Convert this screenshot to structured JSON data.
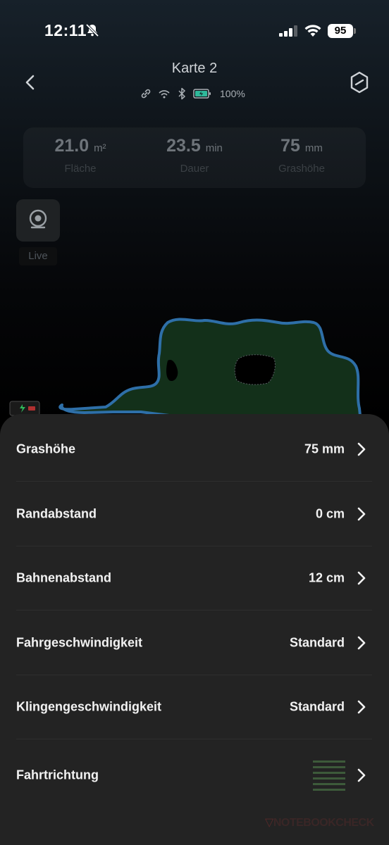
{
  "status": {
    "time": "12:11",
    "battery": "95"
  },
  "header": {
    "title": "Karte 2",
    "battery_pct": "100%"
  },
  "stats": [
    {
      "value": "21.0",
      "unit": "m²",
      "label": "Fläche"
    },
    {
      "value": "23.5",
      "unit": "min",
      "label": "Dauer"
    },
    {
      "value": "75",
      "unit": "mm",
      "label": "Grashöhe"
    }
  ],
  "live": {
    "label": "Live"
  },
  "settings": [
    {
      "label": "Grashöhe",
      "value": "75 mm"
    },
    {
      "label": "Randabstand",
      "value": "0 cm"
    },
    {
      "label": "Bahnenabstand",
      "value": "12 cm"
    },
    {
      "label": "Fahrgeschwindigkeit",
      "value": "Standard"
    },
    {
      "label": "Klingengeschwindigkeit",
      "value": "Standard"
    },
    {
      "label": "Fahrtrichtung",
      "value": ""
    }
  ],
  "watermark": "NOTEBOOKCHECK",
  "colors": {
    "map_fill": "#13301a",
    "map_border": "#2e6fa8",
    "stripe": "#3d5a3a",
    "sheet_bg": "#232323"
  },
  "icons": {
    "back": "chevron-left-icon",
    "settings": "hexagon-icon",
    "live": "camera-icon",
    "row": "chevron-right-icon"
  }
}
